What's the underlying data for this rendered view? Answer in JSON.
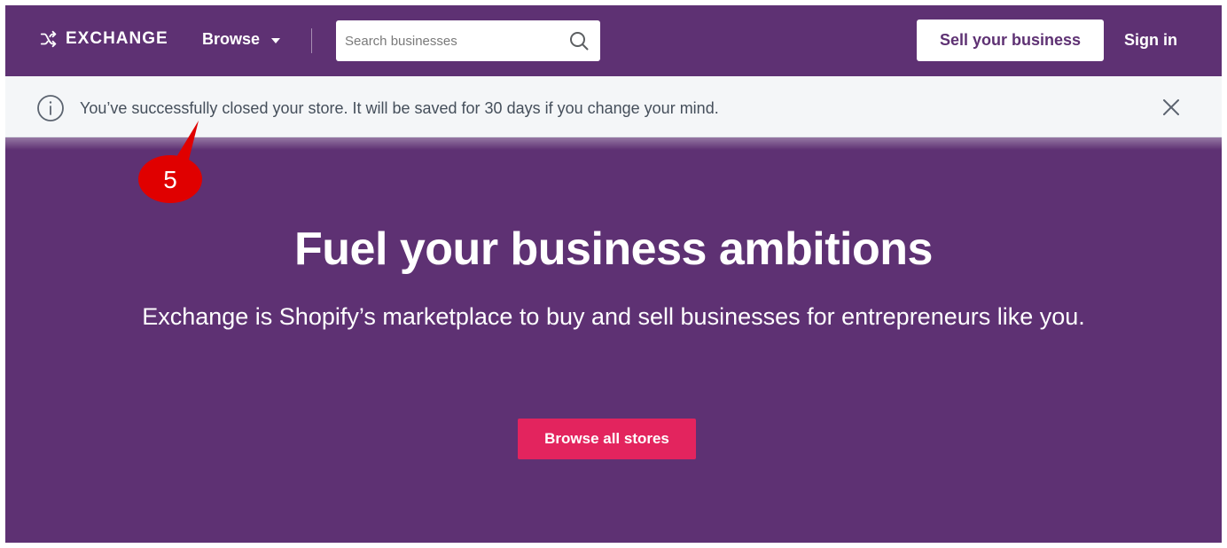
{
  "header": {
    "logo_text": "EXCHANGE",
    "browse_label": "Browse",
    "search_placeholder": "Search businesses",
    "sell_button": "Sell your business",
    "sign_in": "Sign in"
  },
  "banner": {
    "message": "You’ve successfully closed your store. It will be saved for 30 days if you change your mind."
  },
  "annotation": {
    "number": "5"
  },
  "hero": {
    "title": "Fuel your business ambitions",
    "subtitle": "Exchange is Shopify’s marketplace to buy and sell businesses for entrepreneurs like you.",
    "cta_label": "Browse all stores"
  },
  "colors": {
    "brand_purple": "#5e3173",
    "cta_pink": "#e3245e",
    "banner_bg": "#f4f6f8",
    "annotation_red": "#e00000"
  },
  "icons": [
    "shuffle-icon",
    "chevron-down-icon",
    "search-icon",
    "info-icon",
    "close-icon"
  ]
}
